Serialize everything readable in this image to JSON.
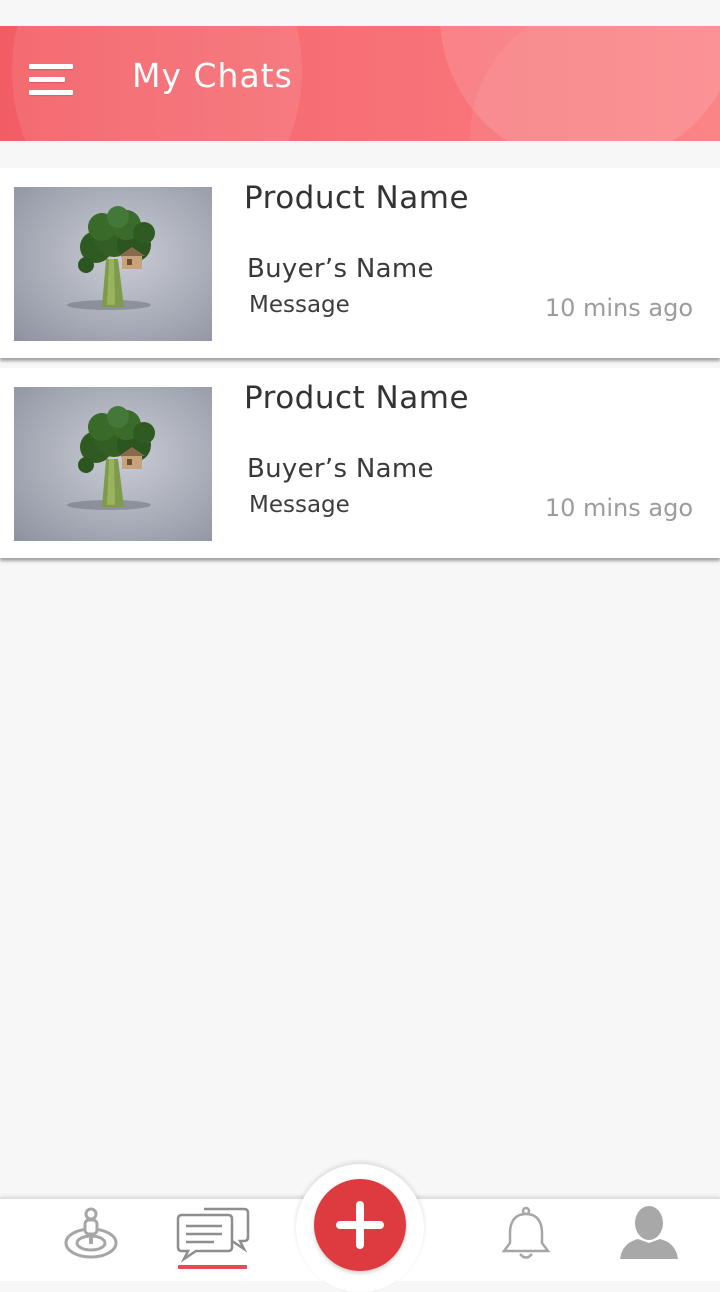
{
  "header": {
    "title": "My Chats",
    "menu_icon": "hamburger-menu-icon",
    "accent": "#f2676c"
  },
  "chats": [
    {
      "product_name": "Product Name",
      "buyer_name": "Buyer’s Name",
      "message": "Message",
      "time": "10 mins ago",
      "thumbnail": "broccoli-treehouse-image"
    },
    {
      "product_name": "Product Name",
      "buyer_name": "Buyer’s Name",
      "message": "Message",
      "time": "10 mins ago",
      "thumbnail": "broccoli-treehouse-image"
    }
  ],
  "bottom_nav": {
    "items": [
      {
        "icon": "location-pin-icon",
        "active": false
      },
      {
        "icon": "chat-bubbles-icon",
        "active": true
      },
      {
        "icon": "plus-icon",
        "active": false
      },
      {
        "icon": "bell-icon",
        "active": false
      },
      {
        "icon": "user-profile-icon",
        "active": false
      }
    ],
    "active_color": "#e64a52",
    "fab_color": "#de3b40"
  }
}
